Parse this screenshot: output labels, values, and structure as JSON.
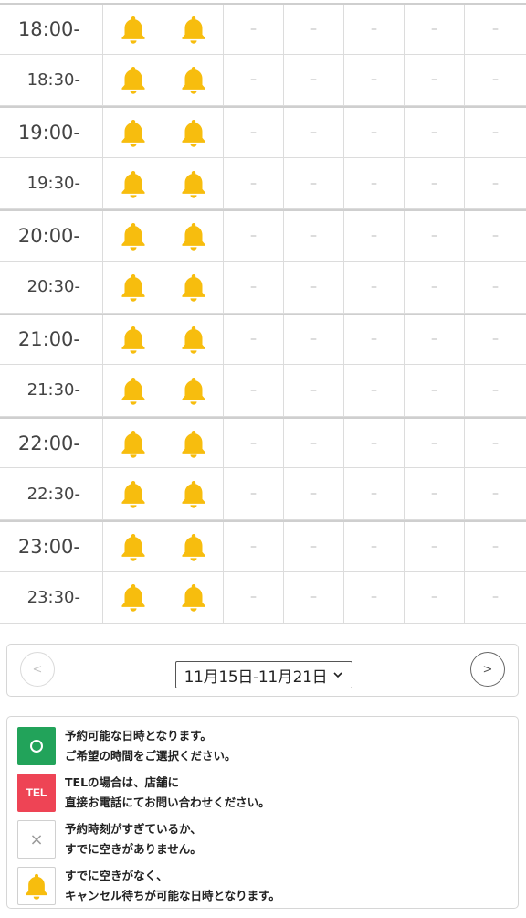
{
  "schedule": {
    "rows": [
      {
        "time": "18:00-",
        "kind": "hour",
        "cells": [
          "bell",
          "bell",
          "–",
          "–",
          "–",
          "–",
          "–"
        ]
      },
      {
        "time": "18:30-",
        "kind": "half",
        "cells": [
          "bell",
          "bell",
          "–",
          "–",
          "–",
          "–",
          "–"
        ]
      },
      {
        "time": "19:00-",
        "kind": "hour",
        "cells": [
          "bell",
          "bell",
          "–",
          "–",
          "–",
          "–",
          "–"
        ]
      },
      {
        "time": "19:30-",
        "kind": "half",
        "cells": [
          "bell",
          "bell",
          "–",
          "–",
          "–",
          "–",
          "–"
        ]
      },
      {
        "time": "20:00-",
        "kind": "hour",
        "cells": [
          "bell",
          "bell",
          "–",
          "–",
          "–",
          "–",
          "–"
        ]
      },
      {
        "time": "20:30-",
        "kind": "half",
        "cells": [
          "bell",
          "bell",
          "–",
          "–",
          "–",
          "–",
          "–"
        ]
      },
      {
        "time": "21:00-",
        "kind": "hour",
        "cells": [
          "bell",
          "bell",
          "–",
          "–",
          "–",
          "–",
          "–"
        ]
      },
      {
        "time": "21:30-",
        "kind": "half",
        "cells": [
          "bell",
          "bell",
          "–",
          "–",
          "–",
          "–",
          "–"
        ]
      },
      {
        "time": "22:00-",
        "kind": "hour",
        "cells": [
          "bell",
          "bell",
          "–",
          "–",
          "–",
          "–",
          "–"
        ]
      },
      {
        "time": "22:30-",
        "kind": "half",
        "cells": [
          "bell",
          "bell",
          "–",
          "–",
          "–",
          "–",
          "–"
        ]
      },
      {
        "time": "23:00-",
        "kind": "hour",
        "cells": [
          "bell",
          "bell",
          "–",
          "–",
          "–",
          "–",
          "–"
        ]
      },
      {
        "time": "23:30-",
        "kind": "half",
        "cells": [
          "bell",
          "bell",
          "–",
          "–",
          "–",
          "–",
          "–"
        ]
      }
    ]
  },
  "nav": {
    "prev_label": "<",
    "next_label": ">",
    "week_selected": "11月15日-11月21日"
  },
  "legend": {
    "available": {
      "icon": "circle-icon",
      "symbol": "○",
      "line1": "予約可能な日時となります。",
      "line2": "ご希望の時間をご選択ください。"
    },
    "tel": {
      "icon": "tel-icon",
      "symbol": "TEL",
      "line1": "TELの場合は、店舗に",
      "line2": "直接お電話にてお問い合わせください。"
    },
    "closed": {
      "icon": "cross-icon",
      "symbol": "×",
      "line1": "予約時刻がすぎているか、",
      "line2": "すでに空きがありません。"
    },
    "waitlist": {
      "icon": "bell-icon",
      "line1": "すでに空きがなく、",
      "line2": "キャンセル待ちが可能な日時となります。"
    }
  },
  "colors": {
    "bell": "#f7bd0e",
    "available": "#22a35a",
    "tel": "#ee4455"
  }
}
